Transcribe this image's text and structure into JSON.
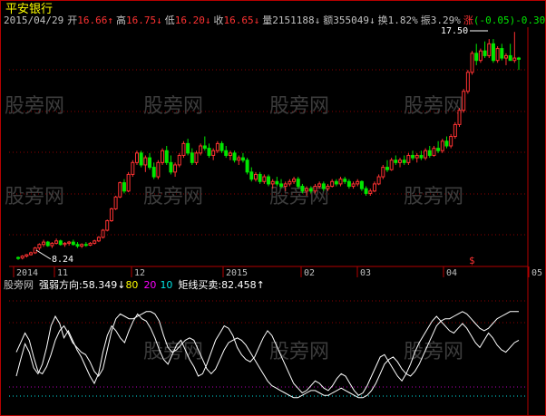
{
  "header": {
    "stock_name": "平安银行",
    "date": "2015/04/29",
    "fields": [
      {
        "label": "开",
        "value": "16.66",
        "arrow": "↑",
        "color": "#ff3232"
      },
      {
        "label": "高",
        "value": "16.75",
        "arrow": "↓",
        "color": "#ff3232"
      },
      {
        "label": "低",
        "value": "16.20",
        "arrow": "↓",
        "color": "#ff3232"
      },
      {
        "label": "收",
        "value": "16.65",
        "arrow": "↓",
        "color": "#ff3232"
      },
      {
        "label": "量",
        "value": "2151188",
        "arrow": "↓",
        "color": "#c0c0c0"
      },
      {
        "label": "额",
        "value": "355049",
        "arrow": "↓",
        "color": "#c0c0c0"
      },
      {
        "label": "换",
        "value": "1.82%",
        "arrow": "",
        "color": "#c0c0c0"
      },
      {
        "label": "振",
        "value": "3.29%",
        "arrow": "",
        "color": "#c0c0c0"
      }
    ],
    "change_label": "涨",
    "change_value": "(-0.05)",
    "change_pct": "-0.30"
  },
  "main_chart": {
    "high_label": "17.50",
    "low_label": "8.24",
    "watermark": "股旁网",
    "marker": "$"
  },
  "time_axis": {
    "labels": [
      "2014",
      "11",
      "12",
      "2015",
      "02",
      "03",
      "04",
      "05"
    ]
  },
  "indicator": {
    "name": "股旁网",
    "strength_label": "强弱方向",
    "strength_value": "58.349",
    "strength_arrow": "↓",
    "level_80": "80",
    "level_20": "20",
    "level_10": "10",
    "rect_label": "矩线买卖",
    "rect_value": "82.458",
    "rect_arrow": "↑"
  },
  "colors": {
    "up": "#ff3232",
    "down": "#00e600",
    "grid": "#8b0000",
    "axis": "#b40000",
    "watermark": "#3c3c3c",
    "line": "#ffffff"
  },
  "chart_data": {
    "type": "candlestick",
    "ylim": [
      8.0,
      18.0
    ],
    "candles": [
      [
        8.3,
        8.35,
        8.2,
        8.28
      ],
      [
        8.28,
        8.4,
        8.22,
        8.36
      ],
      [
        8.36,
        8.45,
        8.3,
        8.42
      ],
      [
        8.42,
        8.55,
        8.38,
        8.5
      ],
      [
        8.5,
        8.75,
        8.45,
        8.7
      ],
      [
        8.7,
        8.9,
        8.6,
        8.85
      ],
      [
        8.85,
        9.05,
        8.75,
        8.95
      ],
      [
        8.95,
        9.0,
        8.75,
        8.8
      ],
      [
        8.8,
        8.95,
        8.7,
        8.9
      ],
      [
        8.9,
        9.1,
        8.85,
        9.0
      ],
      [
        9.0,
        9.05,
        8.8,
        8.85
      ],
      [
        8.85,
        8.95,
        8.75,
        8.9
      ],
      [
        8.9,
        9.0,
        8.8,
        8.95
      ],
      [
        8.95,
        9.05,
        8.8,
        8.85
      ],
      [
        8.85,
        8.95,
        8.7,
        8.78
      ],
      [
        8.78,
        8.9,
        8.7,
        8.85
      ],
      [
        8.85,
        8.95,
        8.75,
        8.82
      ],
      [
        8.82,
        8.95,
        8.78,
        8.9
      ],
      [
        8.9,
        9.05,
        8.85,
        9.0
      ],
      [
        9.0,
        9.2,
        8.95,
        9.15
      ],
      [
        9.15,
        9.5,
        9.1,
        9.45
      ],
      [
        9.45,
        9.9,
        9.4,
        9.85
      ],
      [
        9.85,
        10.4,
        9.8,
        10.35
      ],
      [
        10.35,
        10.9,
        10.3,
        10.85
      ],
      [
        10.85,
        11.5,
        10.8,
        11.45
      ],
      [
        11.45,
        11.6,
        11.0,
        11.1
      ],
      [
        11.1,
        11.9,
        11.05,
        11.8
      ],
      [
        11.8,
        12.4,
        11.7,
        12.3
      ],
      [
        12.3,
        12.8,
        12.2,
        12.7
      ],
      [
        12.7,
        12.8,
        12.1,
        12.2
      ],
      [
        12.2,
        12.6,
        11.9,
        12.5
      ],
      [
        12.5,
        12.7,
        12.0,
        12.1
      ],
      [
        12.1,
        12.3,
        11.6,
        11.7
      ],
      [
        11.7,
        12.4,
        11.6,
        12.3
      ],
      [
        12.3,
        12.9,
        12.2,
        12.8
      ],
      [
        12.8,
        13.0,
        12.2,
        12.3
      ],
      [
        12.3,
        12.6,
        11.8,
        11.9
      ],
      [
        11.9,
        12.3,
        11.7,
        12.2
      ],
      [
        12.2,
        12.7,
        12.1,
        12.6
      ],
      [
        12.6,
        13.2,
        12.5,
        13.1
      ],
      [
        13.1,
        13.3,
        12.6,
        12.7
      ],
      [
        12.7,
        12.9,
        12.2,
        12.3
      ],
      [
        12.3,
        12.8,
        12.2,
        12.7
      ],
      [
        12.7,
        13.1,
        12.6,
        13.0
      ],
      [
        13.0,
        13.4,
        12.8,
        12.9
      ],
      [
        12.9,
        13.1,
        12.5,
        12.6
      ],
      [
        12.6,
        12.9,
        12.4,
        12.8
      ],
      [
        12.8,
        13.2,
        12.7,
        13.1
      ],
      [
        13.1,
        13.2,
        12.7,
        12.8
      ],
      [
        12.8,
        13.0,
        12.5,
        12.6
      ],
      [
        12.6,
        12.8,
        12.4,
        12.7
      ],
      [
        12.7,
        12.8,
        12.3,
        12.4
      ],
      [
        12.4,
        12.6,
        12.2,
        12.5
      ],
      [
        12.5,
        12.7,
        12.3,
        12.4
      ],
      [
        12.4,
        12.5,
        11.8,
        11.9
      ],
      [
        11.9,
        12.1,
        11.5,
        11.6
      ],
      [
        11.6,
        11.9,
        11.5,
        11.8
      ],
      [
        11.8,
        11.9,
        11.4,
        11.5
      ],
      [
        11.5,
        11.8,
        11.4,
        11.7
      ],
      [
        11.7,
        11.8,
        11.3,
        11.4
      ],
      [
        11.4,
        11.6,
        11.2,
        11.5
      ],
      [
        11.5,
        11.7,
        11.3,
        11.4
      ],
      [
        11.4,
        11.6,
        11.2,
        11.3
      ],
      [
        11.3,
        11.5,
        11.1,
        11.4
      ],
      [
        11.4,
        11.6,
        11.3,
        11.5
      ],
      [
        11.5,
        11.7,
        11.4,
        11.6
      ],
      [
        11.6,
        11.7,
        11.2,
        11.3
      ],
      [
        11.3,
        11.4,
        11.0,
        11.1
      ],
      [
        11.1,
        11.3,
        10.9,
        11.2
      ],
      [
        11.2,
        11.3,
        11.0,
        11.1
      ],
      [
        11.1,
        11.4,
        11.0,
        11.3
      ],
      [
        11.3,
        11.5,
        11.2,
        11.4
      ],
      [
        11.4,
        11.5,
        11.1,
        11.2
      ],
      [
        11.2,
        11.4,
        11.1,
        11.3
      ],
      [
        11.3,
        11.6,
        11.25,
        11.5
      ],
      [
        11.5,
        11.6,
        11.3,
        11.4
      ],
      [
        11.4,
        11.7,
        11.3,
        11.6
      ],
      [
        11.6,
        11.7,
        11.4,
        11.5
      ],
      [
        11.5,
        11.6,
        11.2,
        11.3
      ],
      [
        11.3,
        11.5,
        11.2,
        11.4
      ],
      [
        11.4,
        11.6,
        11.3,
        11.5
      ],
      [
        11.5,
        11.55,
        11.1,
        11.2
      ],
      [
        11.2,
        11.3,
        10.9,
        11.0
      ],
      [
        11.0,
        11.2,
        10.9,
        11.1
      ],
      [
        11.1,
        11.5,
        11.05,
        11.4
      ],
      [
        11.4,
        11.8,
        11.35,
        11.7
      ],
      [
        11.7,
        12.2,
        11.6,
        12.1
      ],
      [
        12.1,
        12.4,
        11.9,
        12.0
      ],
      [
        12.0,
        12.5,
        11.95,
        12.4
      ],
      [
        12.4,
        12.6,
        12.2,
        12.3
      ],
      [
        12.3,
        12.5,
        12.1,
        12.4
      ],
      [
        12.4,
        12.6,
        12.2,
        12.3
      ],
      [
        12.3,
        12.7,
        12.2,
        12.6
      ],
      [
        12.6,
        12.8,
        12.4,
        12.5
      ],
      [
        12.5,
        12.7,
        12.3,
        12.6
      ],
      [
        12.6,
        12.8,
        12.4,
        12.5
      ],
      [
        12.5,
        12.9,
        12.4,
        12.8
      ],
      [
        12.8,
        13.0,
        12.5,
        12.6
      ],
      [
        12.6,
        13.0,
        12.55,
        12.9
      ],
      [
        12.9,
        13.2,
        12.7,
        12.8
      ],
      [
        12.8,
        13.3,
        12.7,
        13.2
      ],
      [
        13.2,
        13.4,
        12.9,
        13.0
      ],
      [
        13.0,
        13.5,
        12.9,
        13.4
      ],
      [
        13.4,
        14.0,
        13.3,
        13.9
      ],
      [
        13.9,
        14.6,
        13.8,
        14.5
      ],
      [
        14.5,
        15.4,
        14.4,
        15.3
      ],
      [
        15.3,
        16.2,
        15.2,
        16.1
      ],
      [
        16.1,
        17.0,
        16.0,
        16.9
      ],
      [
        16.9,
        17.3,
        16.4,
        16.6
      ],
      [
        16.6,
        17.1,
        16.5,
        17.0
      ],
      [
        17.0,
        17.4,
        16.7,
        16.8
      ],
      [
        16.8,
        17.5,
        16.7,
        17.3
      ],
      [
        17.3,
        17.5,
        16.5,
        16.6
      ],
      [
        16.6,
        17.2,
        16.5,
        17.1
      ],
      [
        17.1,
        17.3,
        16.6,
        16.7
      ],
      [
        16.7,
        16.9,
        16.4,
        16.8
      ],
      [
        16.8,
        17.3,
        16.6,
        16.6
      ],
      [
        16.6,
        17.8,
        16.5,
        16.7
      ],
      [
        16.7,
        16.75,
        16.2,
        16.65
      ]
    ],
    "indicator_strength": [
      28,
      42,
      55,
      48,
      35,
      30,
      38,
      52,
      70,
      78,
      72,
      60,
      66,
      58,
      50,
      44,
      36,
      28,
      22,
      30,
      48,
      62,
      70,
      66,
      60,
      56,
      66,
      74,
      80,
      76,
      74,
      68,
      60,
      50,
      42,
      38,
      46,
      54,
      58,
      50,
      42,
      36,
      28,
      30,
      38,
      48,
      58,
      64,
      70,
      68,
      62,
      52,
      46,
      42,
      40,
      44,
      52,
      60,
      66,
      62,
      54,
      46,
      38,
      30,
      22,
      18,
      14,
      16,
      20,
      24,
      22,
      18,
      16,
      20,
      26,
      30,
      28,
      22,
      16,
      12,
      14,
      20,
      28,
      36,
      44,
      46,
      40,
      34,
      28,
      24,
      30,
      38,
      48,
      56,
      62,
      68,
      74,
      78,
      74,
      70,
      66,
      64,
      68,
      72,
      68,
      62,
      56,
      52,
      58,
      64,
      60,
      54,
      50,
      48,
      52,
      56,
      58
    ],
    "indicator_rect": [
      48,
      56,
      64,
      58,
      44,
      32,
      30,
      36,
      46,
      58,
      66,
      70,
      64,
      56,
      52,
      48,
      46,
      40,
      32,
      28,
      34,
      50,
      66,
      76,
      80,
      78,
      76,
      76,
      78,
      80,
      82,
      82,
      80,
      74,
      62,
      52,
      48,
      50,
      54,
      58,
      60,
      58,
      50,
      42,
      34,
      30,
      34,
      42,
      50,
      56,
      58,
      60,
      58,
      54,
      48,
      42,
      36,
      30,
      24,
      20,
      18,
      16,
      14,
      12,
      10,
      10,
      12,
      14,
      16,
      16,
      14,
      12,
      12,
      14,
      16,
      18,
      16,
      14,
      12,
      10,
      10,
      12,
      16,
      22,
      30,
      38,
      42,
      44,
      40,
      34,
      30,
      28,
      32,
      38,
      46,
      54,
      62,
      70,
      74,
      76,
      76,
      78,
      80,
      82,
      80,
      76,
      72,
      68,
      66,
      68,
      72,
      76,
      78,
      80,
      82,
      82,
      82
    ]
  }
}
